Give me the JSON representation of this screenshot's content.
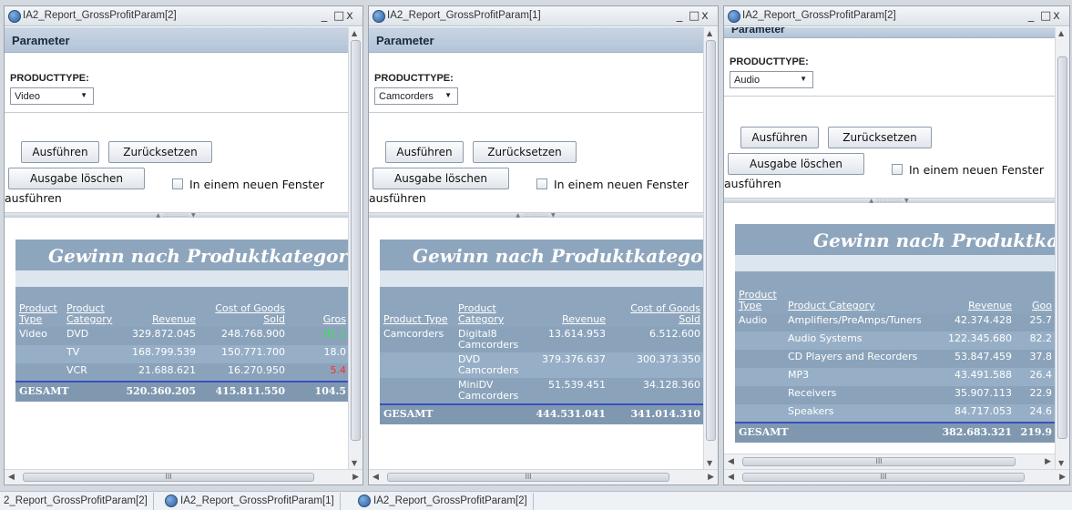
{
  "windows": [
    {
      "title": "IA2_Report_GrossProfitParam[2]",
      "param_header": "Parameter",
      "param_label": "PRODUCTTYPE:",
      "selected": "Video",
      "buttons": {
        "run": "Ausführen",
        "reset": "Zurücksetzen",
        "clear": "Ausgabe löschen"
      },
      "checkbox_label": "In einem neuen Fenster",
      "exec_suffix": "ausführen",
      "report_title": "Gewinn nach Produktkategorie",
      "columns": [
        "Product Type",
        "Product Category",
        "Revenue",
        "Cost of Goods Sold",
        "Gros"
      ],
      "rows": [
        {
          "type": "Video",
          "category": "DVD",
          "revenue": "329.872.045",
          "cost": "248.768.900",
          "gross": "81.1",
          "gross_color": "green"
        },
        {
          "type": "",
          "category": "TV",
          "revenue": "168.799.539",
          "cost": "150.771.700",
          "gross": "18.0",
          "gross_color": ""
        },
        {
          "type": "",
          "category": "VCR",
          "revenue": "21.688.621",
          "cost": "16.270.950",
          "gross": "5.4",
          "gross_color": "red"
        }
      ],
      "total": {
        "label": "GESAMT",
        "revenue": "520.360.205",
        "cost": "415.811.550",
        "gross": "104.5"
      }
    },
    {
      "title": "IA2_Report_GrossProfitParam[1]",
      "param_header": "Parameter",
      "param_label": "PRODUCTTYPE:",
      "selected": "Camcorders",
      "buttons": {
        "run": "Ausführen",
        "reset": "Zurücksetzen",
        "clear": "Ausgabe löschen"
      },
      "checkbox_label": "In einem neuen Fenster",
      "exec_suffix": "ausführen",
      "report_title": "Gewinn nach Produktkategor",
      "columns": [
        "Product Type",
        "Product Category",
        "Revenue",
        "Cost of Goods Sold"
      ],
      "rows": [
        {
          "type": "Camcorders",
          "category": "Digital8 Camcorders",
          "revenue": "13.614.953",
          "cost": "6.512.600"
        },
        {
          "type": "",
          "category": "DVD Camcorders",
          "revenue": "379.376.637",
          "cost": "300.373.350"
        },
        {
          "type": "",
          "category": "MiniDV Camcorders",
          "revenue": "51.539.451",
          "cost": "34.128.360"
        }
      ],
      "total": {
        "label": "GESAMT",
        "revenue": "444.531.041",
        "cost": "341.014.310"
      }
    },
    {
      "title": "IA2_Report_GrossProfitParam[2]",
      "param_header": "Parameter",
      "param_label": "PRODUCTTYPE:",
      "selected": "Audio",
      "buttons": {
        "run": "Ausführen",
        "reset": "Zurücksetzen",
        "clear": "Ausgabe löschen"
      },
      "checkbox_label": "In einem neuen Fenster",
      "exec_suffix": "ausführen",
      "report_title": "Gewinn nach Produktkate",
      "columns": [
        "Product Type",
        "Product Category",
        "Revenue",
        "Goo"
      ],
      "rows": [
        {
          "type": "Audio",
          "category": "Amplifiers/PreAmps/Tuners",
          "revenue": "42.374.428",
          "cost": "25.7"
        },
        {
          "type": "",
          "category": "Audio Systems",
          "revenue": "122.345.680",
          "cost": "82.2"
        },
        {
          "type": "",
          "category": "CD Players and Recorders",
          "revenue": "53.847.459",
          "cost": "37.8"
        },
        {
          "type": "",
          "category": "MP3",
          "revenue": "43.491.588",
          "cost": "26.4"
        },
        {
          "type": "",
          "category": "Receivers",
          "revenue": "35.907.113",
          "cost": "22.9"
        },
        {
          "type": "",
          "category": "Speakers",
          "revenue": "84.717.053",
          "cost": "24.6"
        }
      ],
      "total": {
        "label": "GESAMT",
        "revenue": "382.683.321",
        "cost": "219.9"
      }
    }
  ],
  "taskbar": [
    "2_Report_GrossProfitParam[2]",
    "IA2_Report_GrossProfitParam[1]",
    "IA2_Report_GrossProfitParam[2]"
  ],
  "window_controls": {
    "minimize": "_",
    "maximize": "□",
    "close": "x"
  },
  "scroll_glyphs": {
    "up": "▲",
    "down": "▼",
    "left": "◀",
    "right": "▶",
    "grip": "III",
    "splitter": "▲ ::::::::: ▼",
    "resize": "☰"
  }
}
